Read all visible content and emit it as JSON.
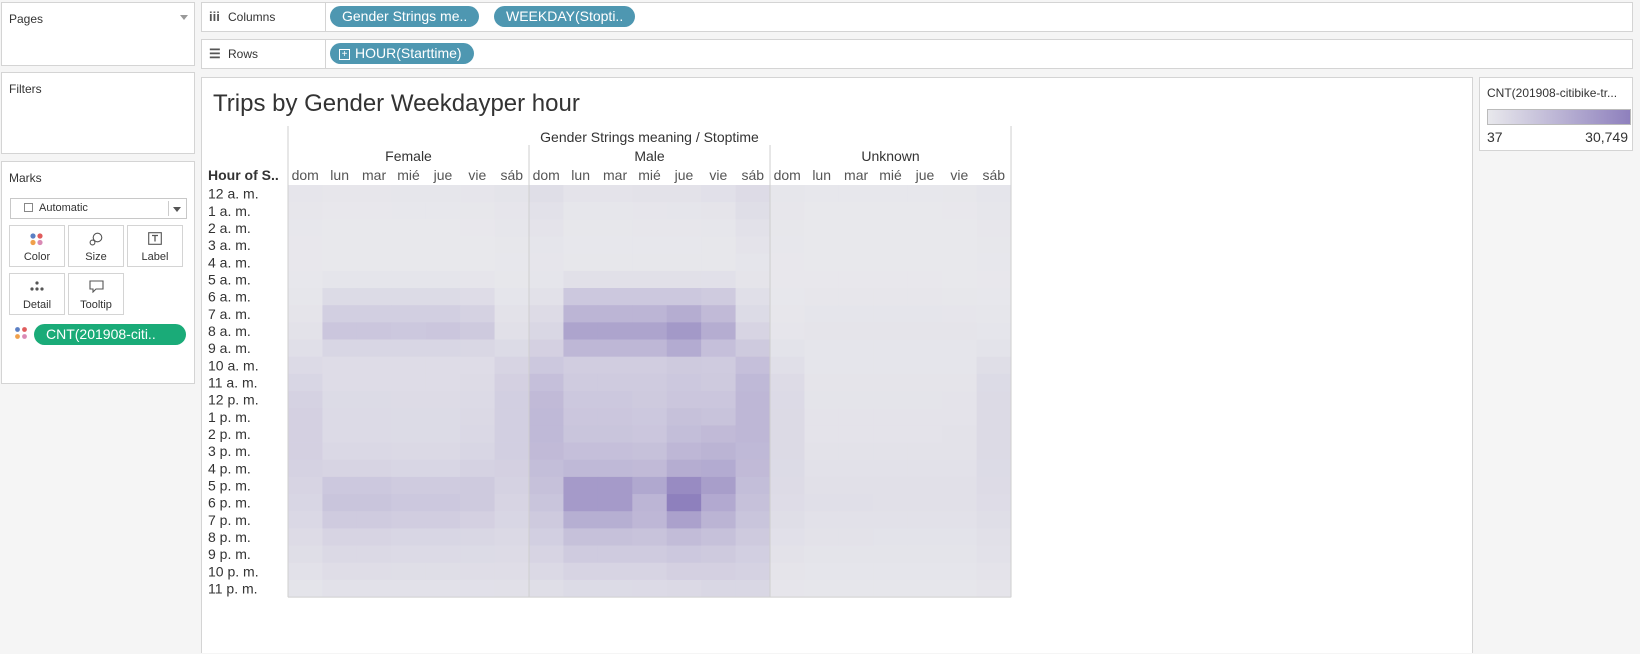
{
  "pages_card": {
    "title": "Pages"
  },
  "filters_card": {
    "title": "Filters"
  },
  "marks_card": {
    "title": "Marks",
    "mark_type": "Automatic",
    "buttons": {
      "color": "Color",
      "size": "Size",
      "label": "Label",
      "detail": "Detail",
      "tooltip": "Tooltip"
    },
    "color_pill": "CNT(201908-citi.."
  },
  "columns_shelf": {
    "label": "Columns",
    "pills": [
      "Gender Strings me..",
      "WEEKDAY(Stopti.."
    ]
  },
  "rows_shelf": {
    "label": "Rows",
    "pills": [
      "HOUR(Starttime)"
    ]
  },
  "legend": {
    "title": "CNT(201908-citibike-tr...",
    "min_label": "37",
    "max_label": "30,749",
    "color_low": "#e8e8ec",
    "color_high": "#8e80bd"
  },
  "chart_data": {
    "type": "heatmap",
    "title": "Trips by Gender Weekdayper hour",
    "column_header": "Gender Strings meaning / Stoptime",
    "row_header": "Hour of S..",
    "groups": [
      "Female",
      "Male",
      "Unknown"
    ],
    "days": [
      "dom",
      "lun",
      "mar",
      "mié",
      "jue",
      "vie",
      "sáb"
    ],
    "hours": [
      "12 a. m.",
      "1 a. m.",
      "2 a. m.",
      "3 a. m.",
      "4 a. m.",
      "5 a. m.",
      "6 a. m.",
      "7 a. m.",
      "8 a. m.",
      "9 a. m.",
      "10 a. m.",
      "11 a. m.",
      "12 p. m.",
      "1 p. m.",
      "2 p. m.",
      "3 p. m.",
      "4 p. m.",
      "5 p. m.",
      "6 p. m.",
      "7 p. m.",
      "8 p. m.",
      "9 p. m.",
      "10 p. m.",
      "11 p. m."
    ],
    "color_range": [
      37,
      30749
    ],
    "series": [
      {
        "name": "Female",
        "values": [
          [
            800,
            500,
            500,
            600,
            600,
            800,
            1300
          ],
          [
            500,
            200,
            200,
            300,
            300,
            400,
            800
          ],
          [
            300,
            150,
            150,
            150,
            150,
            200,
            600
          ],
          [
            200,
            100,
            100,
            100,
            100,
            150,
            400
          ],
          [
            200,
            150,
            150,
            150,
            150,
            150,
            300
          ],
          [
            300,
            900,
            900,
            900,
            900,
            800,
            400
          ],
          [
            700,
            4000,
            4000,
            4000,
            4000,
            3500,
            1000
          ],
          [
            1200,
            7500,
            7500,
            7500,
            7500,
            6500,
            1700
          ],
          [
            1800,
            10000,
            10000,
            9500,
            10000,
            9000,
            2500
          ],
          [
            2700,
            5500,
            5500,
            5500,
            5500,
            5000,
            4000
          ],
          [
            4200,
            3500,
            3500,
            3500,
            3500,
            3500,
            6000
          ],
          [
            5500,
            3500,
            3500,
            3500,
            3500,
            3800,
            7000
          ],
          [
            6500,
            4000,
            4000,
            3800,
            3800,
            4200,
            7500
          ],
          [
            7000,
            4200,
            4200,
            4000,
            4000,
            4500,
            7500
          ],
          [
            7000,
            4200,
            4200,
            4000,
            4000,
            4800,
            7500
          ],
          [
            7000,
            4800,
            4800,
            4500,
            4500,
            5500,
            7500
          ],
          [
            6500,
            6000,
            6000,
            5500,
            5500,
            6500,
            7000
          ],
          [
            6000,
            9500,
            9500,
            8500,
            8500,
            9000,
            6500
          ],
          [
            5500,
            10500,
            10500,
            9500,
            9500,
            9000,
            6000
          ],
          [
            4800,
            8500,
            8500,
            8000,
            8000,
            7000,
            5500
          ],
          [
            3800,
            6000,
            6000,
            5500,
            5500,
            5000,
            4500
          ],
          [
            3000,
            4500,
            4500,
            4200,
            4200,
            4000,
            3800
          ],
          [
            2000,
            3200,
            3200,
            3000,
            3000,
            3200,
            3200
          ],
          [
            1300,
            2000,
            2000,
            2000,
            2000,
            2300,
            2500
          ]
        ]
      },
      {
        "name": "Male",
        "values": [
          [
            3000,
            1500,
            1500,
            1700,
            1800,
            2300,
            3800
          ],
          [
            2100,
            700,
            700,
            800,
            900,
            1100,
            3000
          ],
          [
            1500,
            400,
            400,
            500,
            500,
            600,
            2100
          ],
          [
            1000,
            300,
            300,
            300,
            300,
            400,
            1500
          ],
          [
            800,
            400,
            400,
            400,
            400,
            400,
            1000
          ],
          [
            1000,
            2500,
            2500,
            2500,
            2500,
            2300,
            1200
          ],
          [
            2100,
            9500,
            9500,
            9500,
            9500,
            8500,
            2700
          ],
          [
            3800,
            15000,
            15000,
            15000,
            17500,
            13500,
            4000
          ],
          [
            5200,
            20000,
            20000,
            20000,
            23500,
            17500,
            6000
          ],
          [
            7000,
            14500,
            14500,
            14500,
            18000,
            12000,
            9000
          ],
          [
            9500,
            8000,
            8000,
            8000,
            9000,
            8500,
            12000
          ],
          [
            12000,
            8500,
            8500,
            8500,
            9500,
            9000,
            14000
          ],
          [
            13500,
            9500,
            9500,
            9000,
            10000,
            10000,
            14500
          ],
          [
            14000,
            10000,
            10000,
            9500,
            11500,
            11000,
            14500
          ],
          [
            14000,
            10500,
            10500,
            10000,
            12500,
            13500,
            14500
          ],
          [
            13500,
            12000,
            12000,
            11500,
            14500,
            15500,
            14000
          ],
          [
            12500,
            14000,
            14000,
            13500,
            17500,
            18000,
            13500
          ],
          [
            11500,
            23000,
            23000,
            19000,
            27500,
            22000,
            12500
          ],
          [
            10500,
            23000,
            23000,
            15000,
            30749,
            18500,
            11500
          ],
          [
            9000,
            17000,
            17000,
            14500,
            21000,
            15500,
            10500
          ],
          [
            7500,
            11500,
            11500,
            11000,
            13000,
            11500,
            9000
          ],
          [
            6000,
            8500,
            8500,
            8500,
            9500,
            9000,
            7500
          ],
          [
            4500,
            6000,
            6000,
            6000,
            7000,
            7000,
            6500
          ],
          [
            3000,
            4000,
            4000,
            4200,
            4500,
            5000,
            5000
          ]
        ]
      },
      {
        "name": "Unknown",
        "values": [
          [
            700,
            300,
            300,
            300,
            300,
            400,
            900
          ],
          [
            500,
            150,
            150,
            150,
            150,
            200,
            700
          ],
          [
            400,
            100,
            100,
            100,
            100,
            100,
            500
          ],
          [
            300,
            37,
            37,
            37,
            37,
            37,
            400
          ],
          [
            200,
            37,
            37,
            37,
            37,
            37,
            250
          ],
          [
            200,
            200,
            200,
            200,
            200,
            150,
            200
          ],
          [
            300,
            500,
            500,
            500,
            500,
            450,
            350
          ],
          [
            500,
            900,
            900,
            900,
            900,
            800,
            600
          ],
          [
            800,
            1200,
            1200,
            1200,
            1200,
            1100,
            900
          ],
          [
            1600,
            1000,
            1000,
            1000,
            1000,
            1000,
            1600
          ],
          [
            2800,
            900,
            900,
            900,
            900,
            1000,
            3000
          ],
          [
            3800,
            1100,
            1100,
            1100,
            1100,
            1200,
            4000
          ],
          [
            4200,
            1300,
            1300,
            1300,
            1300,
            1400,
            4300
          ],
          [
            4300,
            1400,
            1400,
            1400,
            1400,
            1500,
            4300
          ],
          [
            4300,
            1500,
            1500,
            1500,
            1500,
            1700,
            4300
          ],
          [
            4300,
            1700,
            1700,
            1700,
            1700,
            1900,
            4300
          ],
          [
            4000,
            2000,
            2000,
            2000,
            2000,
            2100,
            4000
          ],
          [
            3800,
            2500,
            2500,
            2400,
            2400,
            2500,
            3800
          ],
          [
            3500,
            2700,
            2700,
            2500,
            2500,
            2500,
            3500
          ],
          [
            3000,
            2200,
            2200,
            2100,
            2100,
            2100,
            3100
          ],
          [
            2300,
            1700,
            1700,
            1600,
            1600,
            1600,
            2500
          ],
          [
            1700,
            1300,
            1300,
            1300,
            1300,
            1300,
            2000
          ],
          [
            1100,
            900,
            900,
            900,
            900,
            1000,
            1500
          ],
          [
            800,
            600,
            600,
            600,
            600,
            700,
            1200
          ]
        ]
      }
    ]
  }
}
